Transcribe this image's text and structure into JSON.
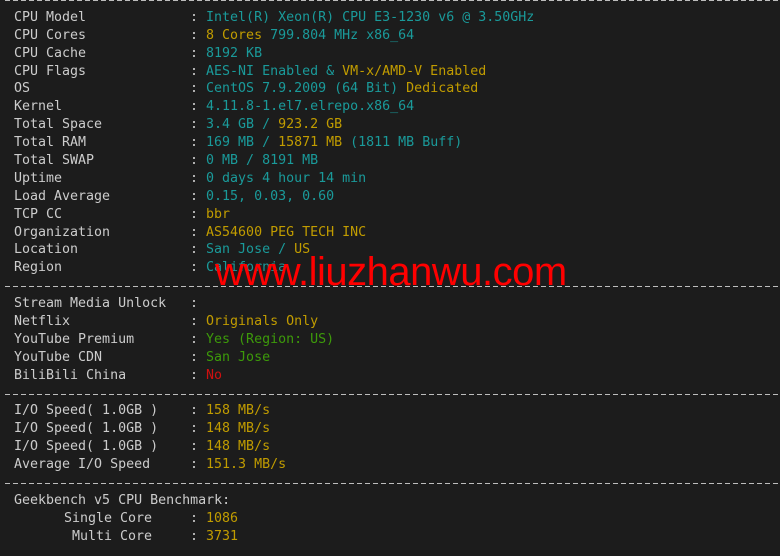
{
  "colors": {
    "label": "#cccccc",
    "teal": "#1a9a9a",
    "yellow": "#c19c00",
    "green": "#3d9a0a",
    "red": "#d01010",
    "background": "#1c1c1c",
    "watermark": "#ff0000"
  },
  "separator": ":",
  "lines": [
    {
      "type": "divider"
    },
    {
      "label": "CPU Model",
      "value": [
        {
          "text": "Intel(R) Xeon(R) CPU E3-1230 v6 @ 3.50GHz",
          "color": "teal"
        }
      ]
    },
    {
      "label": "CPU Cores",
      "value": [
        {
          "text": "8 Cores ",
          "color": "yellow"
        },
        {
          "text": "799.804 MHz x86_64",
          "color": "teal"
        }
      ]
    },
    {
      "label": "CPU Cache",
      "value": [
        {
          "text": "8192 KB",
          "color": "teal"
        }
      ]
    },
    {
      "label": "CPU Flags",
      "value": [
        {
          "text": "AES-NI Enabled & ",
          "color": "teal"
        },
        {
          "text": "VM-x/AMD-V Enabled",
          "color": "yellow"
        }
      ]
    },
    {
      "label": "OS",
      "value": [
        {
          "text": "CentOS 7.9.2009 (64 Bit) ",
          "color": "teal"
        },
        {
          "text": "Dedicated",
          "color": "yellow"
        }
      ]
    },
    {
      "label": "Kernel",
      "value": [
        {
          "text": "4.11.8-1.el7.elrepo.x86_64",
          "color": "teal"
        }
      ]
    },
    {
      "label": "Total Space",
      "value": [
        {
          "text": "3.4 GB / ",
          "color": "teal"
        },
        {
          "text": "923.2 GB",
          "color": "yellow"
        }
      ]
    },
    {
      "label": "Total RAM",
      "value": [
        {
          "text": "169 MB / ",
          "color": "teal"
        },
        {
          "text": "15871 MB",
          "color": "yellow"
        },
        {
          "text": " (1811 MB Buff)",
          "color": "teal"
        }
      ]
    },
    {
      "label": "Total SWAP",
      "value": [
        {
          "text": "0 MB / 8191 MB",
          "color": "teal"
        }
      ]
    },
    {
      "label": "Uptime",
      "value": [
        {
          "text": "0 days 4 hour 14 min",
          "color": "teal"
        }
      ]
    },
    {
      "label": "Load Average",
      "value": [
        {
          "text": "0.15, 0.03, 0.60",
          "color": "teal"
        }
      ]
    },
    {
      "label": "TCP CC",
      "value": [
        {
          "text": "bbr",
          "color": "yellow"
        }
      ]
    },
    {
      "label": "Organization",
      "value": [
        {
          "text": "AS54600 PEG TECH INC",
          "color": "yellow"
        }
      ]
    },
    {
      "label": "Location",
      "value": [
        {
          "text": "San Jose / ",
          "color": "teal"
        },
        {
          "text": "US",
          "color": "yellow"
        }
      ]
    },
    {
      "label": "Region",
      "value": [
        {
          "text": "California",
          "color": "teal"
        }
      ]
    },
    {
      "type": "divider"
    },
    {
      "label": "Stream Media Unlock",
      "value": []
    },
    {
      "label": "Netflix",
      "value": [
        {
          "text": "Originals Only",
          "color": "yellow"
        }
      ]
    },
    {
      "label": "YouTube Premium",
      "value": [
        {
          "text": "Yes (Region: US)",
          "color": "green"
        }
      ]
    },
    {
      "label": "YouTube CDN",
      "value": [
        {
          "text": "San Jose",
          "color": "green"
        }
      ]
    },
    {
      "label": "BiliBili China",
      "value": [
        {
          "text": "No",
          "color": "red"
        }
      ]
    },
    {
      "type": "divider"
    },
    {
      "label": "I/O Speed( 1.0GB )",
      "value": [
        {
          "text": "158 MB/s",
          "color": "yellow"
        }
      ]
    },
    {
      "label": "I/O Speed( 1.0GB )",
      "value": [
        {
          "text": "148 MB/s",
          "color": "yellow"
        }
      ]
    },
    {
      "label": "I/O Speed( 1.0GB )",
      "value": [
        {
          "text": "148 MB/s",
          "color": "yellow"
        }
      ]
    },
    {
      "label": "Average I/O Speed",
      "value": [
        {
          "text": "151.3 MB/s",
          "color": "yellow"
        }
      ]
    },
    {
      "type": "divider"
    },
    {
      "type": "heading",
      "label": "Geekbench v5 CPU Benchmark:"
    },
    {
      "label": "Single Core",
      "indent": 1,
      "value": [
        {
          "text": "1086",
          "color": "yellow"
        }
      ]
    },
    {
      "label": "Multi Core",
      "indent": 2,
      "value": [
        {
          "text": "3731",
          "color": "yellow"
        }
      ]
    }
  ],
  "watermark": "www.liuzhanwu.com"
}
